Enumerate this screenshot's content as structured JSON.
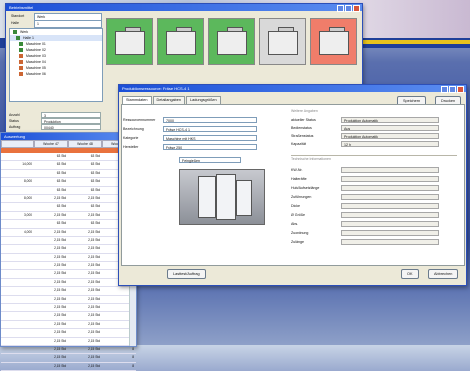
{
  "win1": {
    "title": "Betriebsmittel",
    "combo1_label": "Standort",
    "combo1_value": "Werk",
    "combo2_label": "Halle",
    "combo2_value": "1",
    "tree": [
      "Werk",
      "Halle 1",
      "Maschine 01",
      "Maschine 02",
      "Maschine 03",
      "Maschine 04",
      "Maschine 05",
      "Maschine 06"
    ],
    "props": [
      [
        "Anzahl",
        "3"
      ],
      [
        "Status",
        "Produktion"
      ],
      [
        "Auftrag",
        "00440"
      ]
    ]
  },
  "win2": {
    "title": "Auswertung",
    "headers": [
      "",
      "Woche 47",
      "Woche 48",
      "Woche 49"
    ],
    "rows": [
      [
        "",
        "63 Std",
        "63 Std",
        ""
      ],
      [
        "14,000",
        "63 Std",
        "63 Std",
        ""
      ],
      [
        "",
        "63 Std",
        "63 Std",
        ""
      ],
      [
        "8,000",
        "63 Std",
        "63 Std",
        ""
      ],
      [
        "",
        "63 Std",
        "63 Std",
        ""
      ],
      [
        "8,000",
        "2,15 Std",
        "2,15 Std",
        "8"
      ],
      [
        "",
        "63 Std",
        "63 Std",
        ""
      ],
      [
        "3,000",
        "2,15 Std",
        "2,15 Std",
        "8"
      ],
      [
        "",
        "63 Std",
        "63 Std",
        ""
      ],
      [
        "4,000",
        "2,15 Std",
        "2,15 Std",
        "8"
      ],
      [
        "",
        "2,15 Std",
        "2,15 Std",
        "8"
      ],
      [
        "",
        "2,15 Std",
        "2,15 Std",
        "8"
      ],
      [
        "",
        "2,15 Std",
        "2,15 Std",
        "8"
      ],
      [
        "",
        "2,15 Std",
        "2,15 Std",
        "8"
      ],
      [
        "",
        "2,15 Std",
        "2,15 Std",
        "8"
      ],
      [
        "",
        "2,15 Std",
        "2,15 Std",
        "8"
      ],
      [
        "",
        "2,15 Std",
        "2,15 Std",
        "8"
      ],
      [
        "",
        "2,15 Std",
        "2,15 Std",
        "8"
      ],
      [
        "",
        "2,15 Std",
        "2,15 Std",
        "8"
      ],
      [
        "",
        "2,15 Std",
        "2,15 Std",
        "8"
      ],
      [
        "",
        "2,15 Std",
        "2,15 Std",
        "8"
      ],
      [
        "",
        "2,15 Std",
        "2,15 Std",
        "8"
      ],
      [
        "",
        "2,15 Std",
        "2,15 Std",
        "8"
      ],
      [
        "",
        "2,15 Std",
        "2,15 Std",
        "8"
      ],
      [
        "",
        "2,15 Std",
        "2,15 Std",
        "8"
      ],
      [
        "",
        "2,15 Std",
        "2,15 Std",
        "8"
      ]
    ]
  },
  "win3": {
    "title": "Produktionsressource: Fräse HCS-4 1",
    "tabs": [
      "Stammdaten",
      "Detailangaben",
      "Ladungsgrößen"
    ],
    "btn_speichern": "Speichern",
    "btn_drucken": "Drucken",
    "left_fields": [
      [
        "Ressourcennummer",
        "7000"
      ],
      [
        "Bezeichnung",
        "Fräse HCS-4 1"
      ],
      [
        "Kategorie",
        "Maschine mit HKS"
      ],
      [
        "Hersteller",
        "Fräse 250"
      ]
    ],
    "dropdown": "Feingießen",
    "right_group_label": "Weitere Angaben",
    "right_fields_top": [
      [
        "aktueller Status",
        "Produktion Automatik"
      ],
      [
        "Bedienstatus",
        "Aus"
      ],
      [
        "Straßenstatus",
        "Produktion Automatik"
      ],
      [
        "Kapazität",
        "12 h"
      ]
    ],
    "lower_group_label": "Technische Informationen",
    "right_fields_bottom": [
      "KW-Nr.",
      "Halteräfte",
      "Hub/Aufsetzlänge",
      "Zuführungen",
      "Dicke",
      "Ø Größe",
      "Abs.",
      "Zuordnung",
      "Zulänge"
    ],
    "btn_left": "Lasttest/Auftrag",
    "btn_ok": "OK",
    "btn_abbrechen": "Abbrechen"
  },
  "colors": {
    "title_blue": "#1b4fd7",
    "card_green": "#5cb85c",
    "card_gray": "#d9d9d9",
    "card_red": "#f07d6a",
    "accent_orange": "#e9723d",
    "band_yellow": "#e8c31c"
  }
}
